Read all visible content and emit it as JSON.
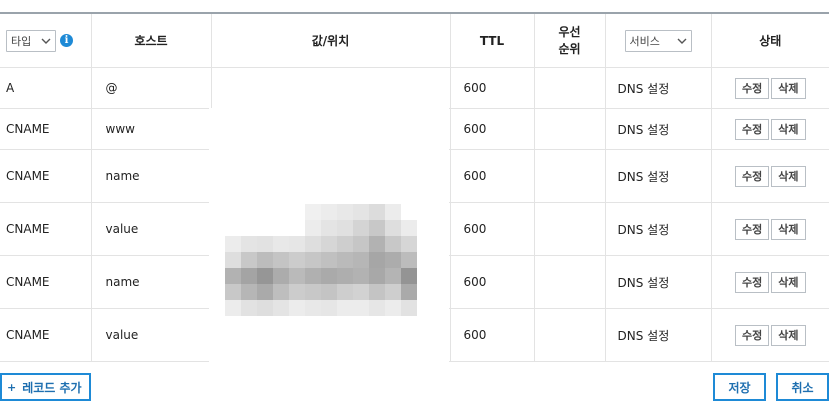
{
  "header": {
    "type_select": "타입",
    "info": "i",
    "host": "호스트",
    "value": "값/위치",
    "ttl": "TTL",
    "priority_line1": "우선",
    "priority_line2": "순위",
    "service_select": "서비스",
    "status": "상태"
  },
  "rows": [
    {
      "type": "A",
      "host": "@",
      "value": "",
      "ttl": "600",
      "priority": "",
      "service": "DNS 설정",
      "edit": "수정",
      "delete": "삭제"
    },
    {
      "type": "CNAME",
      "host": "www",
      "value": "",
      "ttl": "600",
      "priority": "",
      "service": "DNS 설정",
      "edit": "수정",
      "delete": "삭제"
    },
    {
      "type": "CNAME",
      "host": "name",
      "value": "",
      "ttl": "600",
      "priority": "",
      "service": "DNS 설정",
      "edit": "수정",
      "delete": "삭제"
    },
    {
      "type": "CNAME",
      "host": "value",
      "value": "",
      "ttl": "600",
      "priority": "",
      "service": "DNS 설정",
      "edit": "수정",
      "delete": "삭제"
    },
    {
      "type": "CNAME",
      "host": "name",
      "value": "",
      "ttl": "600",
      "priority": "",
      "service": "DNS 설정",
      "edit": "수정",
      "delete": "삭제"
    },
    {
      "type": "CNAME",
      "host": "value",
      "value": "",
      "ttl": "600",
      "priority": "",
      "service": "DNS 설정",
      "edit": "수정",
      "delete": "삭제"
    }
  ],
  "footer": {
    "add_icon": "+",
    "add_label": "레코드 추가",
    "save_label": "저장",
    "cancel_label": "취소"
  },
  "colors": {
    "accent": "#1e8ad6",
    "border": "#e3e3e3",
    "header_top_border": "#9aa3ab"
  }
}
